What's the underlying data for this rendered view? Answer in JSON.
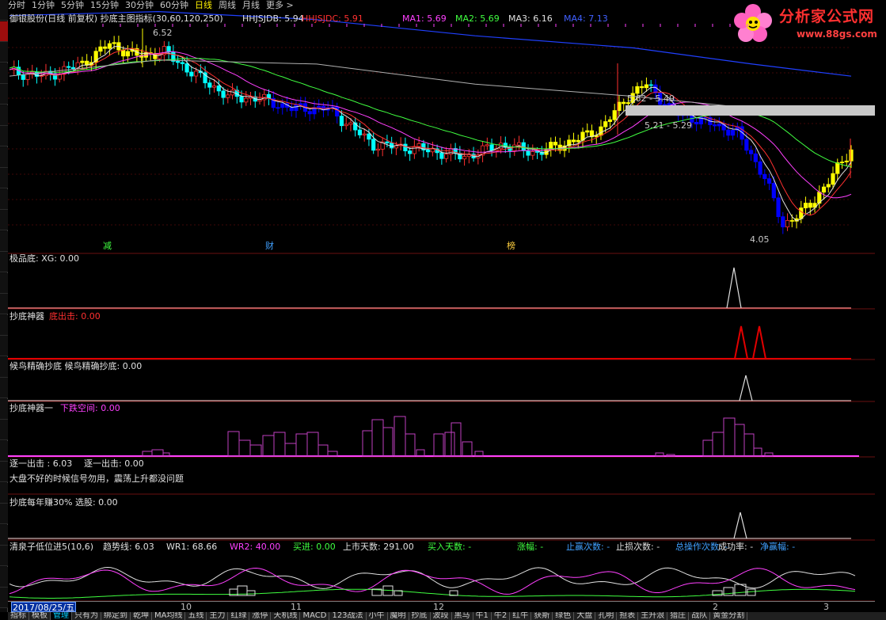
{
  "menu": [
    "分时",
    "1分钟",
    "5分钟",
    "15分钟",
    "30分钟",
    "60分钟",
    "日线",
    "周线",
    "月线",
    "更多 >"
  ],
  "menu_active": "日线",
  "logo": {
    "text": "分析家公式网",
    "url": "www.88gs.com"
  },
  "main": {
    "title": "御银股份(日线 前复权) 抄底主图指标(30,60,120,250)",
    "indicators": [
      {
        "label": "HHJSJDB: 5.94",
        "color": "#e0e0e0"
      },
      {
        "label": "HHJSJDC: 5.91",
        "color": "#ff3030"
      },
      {
        "label": "MA1: 5.69",
        "color": "#ff40ff"
      },
      {
        "label": "MA2: 5.69",
        "color": "#40ff40"
      },
      {
        "label": "MA3: 6.16",
        "color": "#e0e0e0"
      },
      {
        "label": "MA4: 7.13",
        "color": "#4060ff"
      }
    ],
    "annotations": {
      "high": "6.52",
      "resist1": "5.62 - 5.49",
      "resist2": "5.21 - 5.29",
      "low": "4.05"
    },
    "events": [
      {
        "text": "减",
        "color": "#40ff40"
      },
      {
        "text": "财",
        "color": "#40a0ff"
      },
      {
        "text": "榜",
        "color": "#ffd040"
      }
    ]
  },
  "panels": [
    {
      "title": "极品底: XG: 0.00",
      "color": "#e0e0e0"
    },
    {
      "title": "抄底神器",
      "sub": "底出击: 0.00",
      "color": "#e0e0e0",
      "subcolor": "#ff3030"
    },
    {
      "title": "候鸟精确抄底  候鸟精确抄底: 0.00",
      "color": "#e0e0e0"
    },
    {
      "title": "抄底神器一",
      "sub": "下跌空间: 0.00",
      "color": "#e0e0e0",
      "subcolor": "#ff40ff"
    },
    {
      "title": "逐一出击 : 6.03",
      "sub": "逐一出击: 0.00",
      "color": "#e0e0e0",
      "subcolor": "#e0e0e0",
      "note": "大盘不好的时候信号勿用，震荡上升都没问题"
    },
    {
      "title": "抄底每年赚30% 选股: 0.00",
      "color": "#e0e0e0"
    },
    {
      "title": "清泉子低位进5(10,6)",
      "color": "#e0e0e0",
      "stats": [
        {
          "label": "趋势线: 6.03",
          "color": "#e0e0e0"
        },
        {
          "label": "WR1: 68.66",
          "color": "#e0e0e0"
        },
        {
          "label": "WR2: 40.00",
          "color": "#ff40ff"
        },
        {
          "label": "买进: 0.00",
          "color": "#40ff40"
        },
        {
          "label": "上市天数: 291.00",
          "color": "#e0e0e0"
        },
        {
          "label": "买入天数: -",
          "color": "#40ff40"
        },
        {
          "label": "涨幅: -",
          "color": "#40ff40"
        },
        {
          "label": "止赢次数: -",
          "color": "#40a0ff"
        },
        {
          "label": "止损次数: -",
          "color": "#e0e0e0"
        },
        {
          "label": "总操作次数: -",
          "color": "#40a0ff"
        },
        {
          "label": "成功率: -",
          "color": "#e0e0e0"
        },
        {
          "label": "净赢幅: -",
          "color": "#40a0ff"
        }
      ]
    }
  ],
  "date_axis": {
    "current": "2017/08/25/五",
    "ticks": [
      "10",
      "11",
      "12",
      "2",
      "3"
    ]
  },
  "bottom_tabs": [
    "指标",
    "模板",
    "管理",
    "只有为",
    "绑定到",
    "乾坤",
    "MA均线",
    "五线",
    "主力",
    "红绿",
    "涨停",
    "天机线",
    "MACD",
    "123战法",
    "小牛",
    "魔明",
    "抄底",
    "波段",
    "黑马",
    "牛1",
    "牛2",
    "红牛",
    "获斯",
    "绿色",
    "大盘",
    "孔明",
    "担表",
    "主升浪",
    "猎庄",
    "战队",
    "黄金分割"
  ],
  "bottom_active": "管理",
  "colors": {
    "up": "#ff3030",
    "down": "#00ffff",
    "yellow": "#ffff00",
    "blue": "#0000ff",
    "grid": "#6a1010"
  }
}
